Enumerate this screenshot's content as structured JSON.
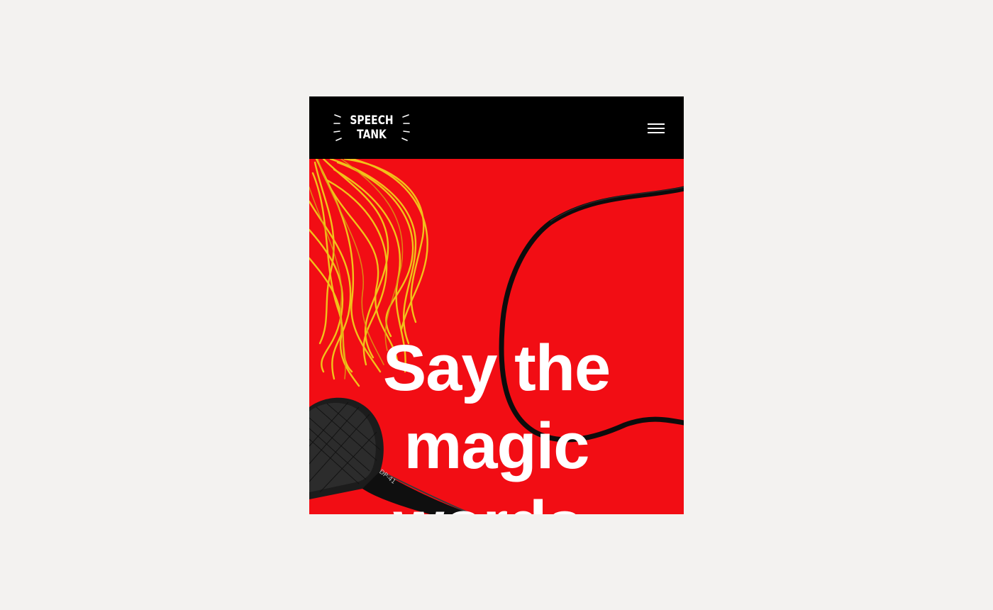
{
  "brand": {
    "name_line1": "SPEECH",
    "name_line2": "TANK"
  },
  "nav": {
    "menu_icon": "hamburger-menu-icon"
  },
  "hero": {
    "headline_line1": "Say the",
    "headline_line2": "magic",
    "headline_line3": "words.",
    "background_color": "#f20d14",
    "microphone_brand": "DP-41"
  },
  "colors": {
    "page_background": "#f3f2f0",
    "navbar": "#000000",
    "accent_red": "#f20d14",
    "tassel_yellow": "#f2c11a",
    "text": "#ffffff"
  }
}
